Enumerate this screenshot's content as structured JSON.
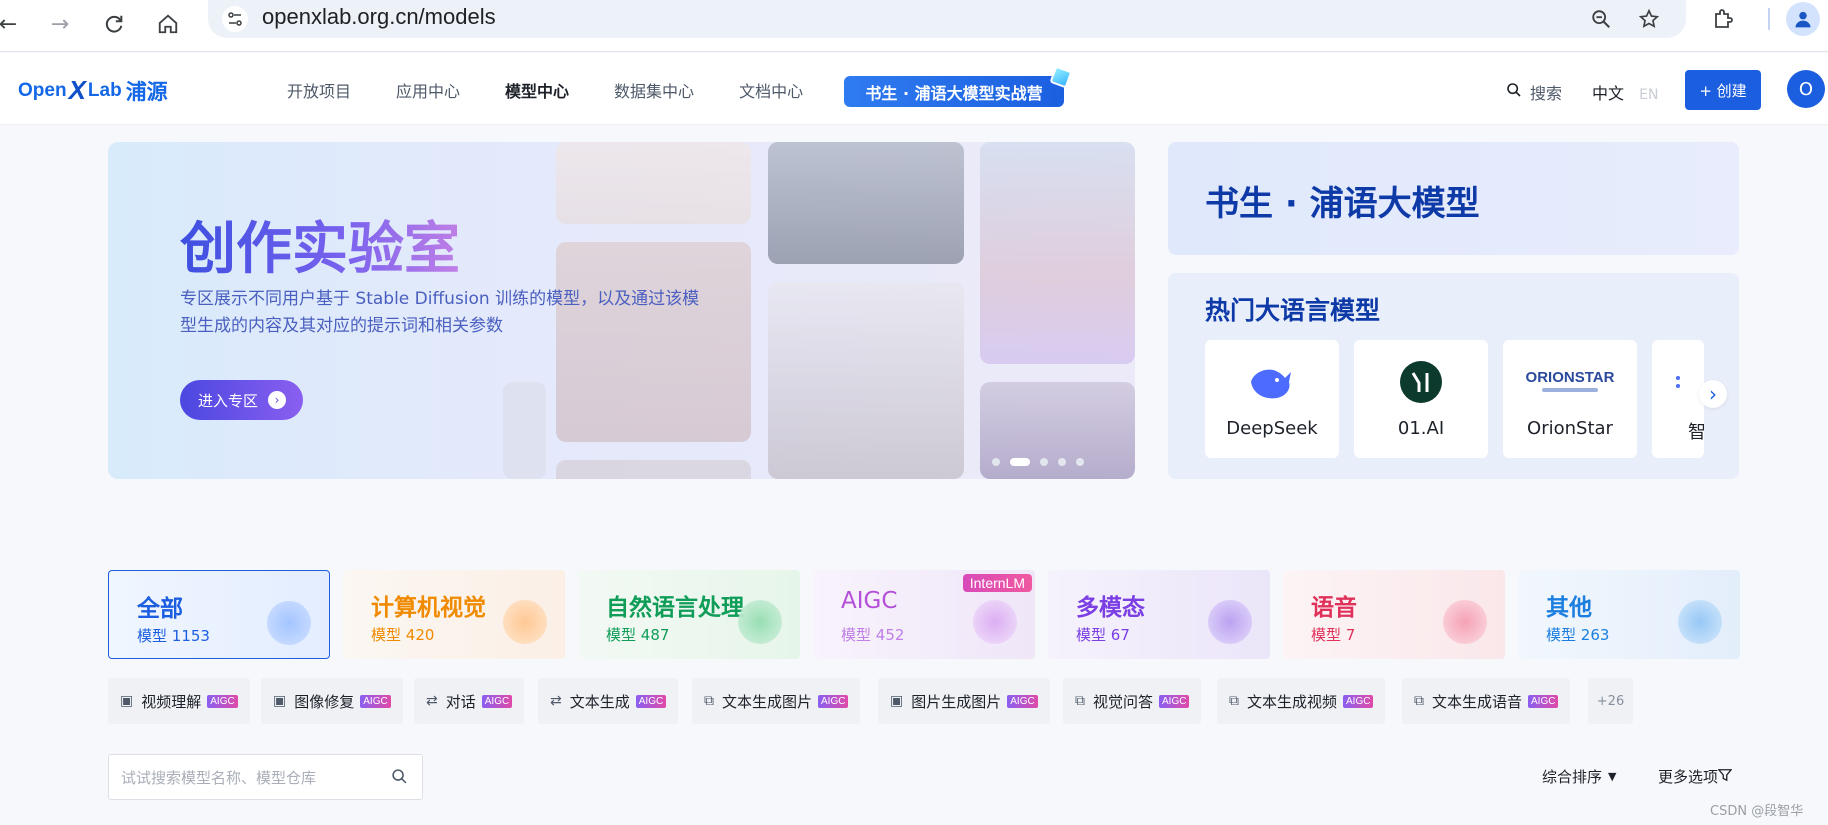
{
  "browser": {
    "url": "openxlab.org.cn/models"
  },
  "header": {
    "logo_open": "Open",
    "logo_x": "X",
    "logo_lab": "Lab",
    "logo_cn": "浦源",
    "nav": [
      "开放项目",
      "应用中心",
      "模型中心",
      "数据集中心",
      "文档中心"
    ],
    "active_nav": "模型中心",
    "promo": "书生 · 浦语大模型实战营",
    "search_label": "搜索",
    "lang_zh": "中文",
    "lang_en": "EN",
    "create_label": "+ 创建",
    "avatar_letter": "O"
  },
  "hero": {
    "title": "创作实验室",
    "desc": "专区展示不同用户基于 Stable Diffusion 训练的模型，以及通过该模型生成的内容及其对应的提示词和相关参数",
    "button_label": "进入专区"
  },
  "intern": {
    "title": "书生 · 浦语大模型"
  },
  "hot": {
    "title": "热门大语言模型",
    "brands": [
      "DeepSeek",
      "01.AI",
      "OrionStar",
      "智"
    ]
  },
  "categories": [
    {
      "name": "全部",
      "count_label": "模型",
      "count": "1153",
      "color": "#1c5ee0"
    },
    {
      "name": "计算机视觉",
      "count_label": "模型",
      "count": "420",
      "color": "#f08a00"
    },
    {
      "name": "自然语言处理",
      "count_label": "模型",
      "count": "487",
      "color": "#0f9d58"
    },
    {
      "name": "AIGC",
      "count_label": "模型",
      "count": "452",
      "color": "#b44fd8",
      "badge": "InternLM"
    },
    {
      "name": "多模态",
      "count_label": "模型",
      "count": "67",
      "color": "#7b3fe4"
    },
    {
      "name": "语音",
      "count_label": "模型",
      "count": "7",
      "color": "#e0315a"
    },
    {
      "name": "其他",
      "count_label": "模型",
      "count": "263",
      "color": "#1c7fe0"
    }
  ],
  "tags": [
    {
      "label": "视频理解",
      "badge": "AIGC"
    },
    {
      "label": "图像修复",
      "badge": "AIGC"
    },
    {
      "label": "对话",
      "badge": "AIGC"
    },
    {
      "label": "文本生成",
      "badge": "AIGC"
    },
    {
      "label": "文本生成图片",
      "badge": "AIGC"
    },
    {
      "label": "图片生成图片",
      "badge": "AIGC"
    },
    {
      "label": "视觉问答",
      "badge": "AIGC"
    },
    {
      "label": "文本生成视频",
      "badge": "AIGC"
    },
    {
      "label": "文本生成语音",
      "badge": "AIGC"
    }
  ],
  "tags_more": "+26",
  "search": {
    "placeholder": "试试搜索模型名称、模型仓库"
  },
  "sort_label": "综合排序",
  "more_options_label": "更多选项",
  "watermark": "CSDN @段智华"
}
